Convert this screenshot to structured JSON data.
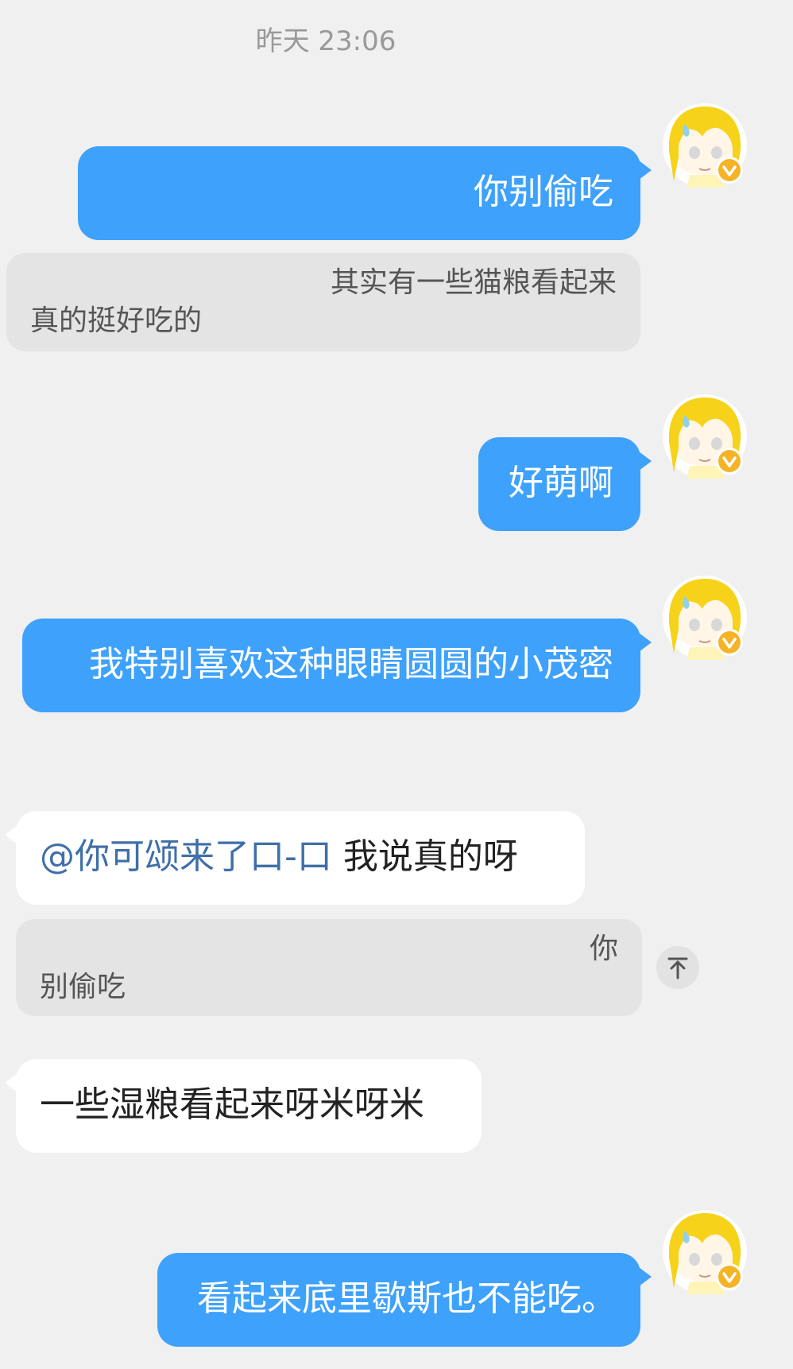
{
  "chat": {
    "timestamp": "昨天 23:06",
    "messages": [
      {
        "text": "你别偷吃"
      },
      {
        "quote_line1": "其实有一些猫粮看起来",
        "quote_line2": "真的挺好吃的"
      },
      {
        "text": "好萌啊"
      },
      {
        "text": "我特别喜欢这种眼睛圆圆的小茂密"
      },
      {
        "mention": "@你可颂来了口-口",
        "text": "我说真的呀"
      },
      {
        "quote_line1": "你",
        "quote_line2": "别偷吃"
      },
      {
        "text": "一些湿粮看起来呀米呀米"
      },
      {
        "text": "看起来底里歇斯也不能吃。"
      }
    ]
  },
  "colors": {
    "background": "#f0f0f0",
    "outgoing_bubble": "#3ea1fb",
    "incoming_bubble": "#ffffff",
    "quote_bg": "#e4e4e4",
    "mention": "#3f6fa8",
    "verified_badge": "#f5b325",
    "avatar_hair": "#f7d21b"
  },
  "icons": {
    "avatar": "avatar-anime-girl-icon",
    "verified": "verified-badge-icon",
    "scroll_top": "arrow-up-icon"
  }
}
